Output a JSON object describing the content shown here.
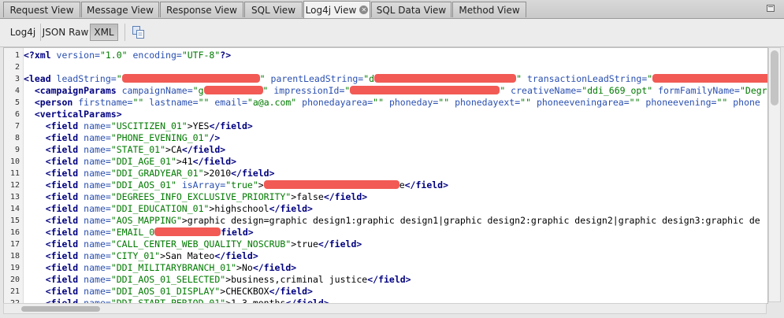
{
  "tabs": [
    {
      "label": "Request View"
    },
    {
      "label": "Message View"
    },
    {
      "label": "Response View"
    },
    {
      "label": "SQL View"
    },
    {
      "label": "Log4j View",
      "active": true,
      "closable": true
    },
    {
      "label": "SQL Data View"
    },
    {
      "label": "Method View"
    }
  ],
  "toolbar": {
    "log4j_label": "Log4j",
    "json_raw_label": "JSON Raw",
    "xml_label": "XML",
    "selected": "XML",
    "copy_icon": "copy-icon"
  },
  "editor": {
    "lines": [
      {
        "n": "1",
        "s": [
          [
            "t",
            "<?xml"
          ],
          [
            "a",
            " version="
          ],
          [
            "v",
            "\"1.0\""
          ],
          [
            "a",
            " encoding="
          ],
          [
            "v",
            "\"UTF-8\""
          ],
          [
            "t",
            "?>"
          ]
        ]
      },
      {
        "n": "2",
        "s": []
      },
      {
        "n": "3",
        "s": [
          [
            "t",
            "<lead"
          ],
          [
            "a",
            " leadString="
          ],
          [
            "v",
            "\""
          ],
          [
            "r",
            "175"
          ],
          [
            "v",
            "\""
          ],
          [
            "a",
            " parentLeadString="
          ],
          [
            "v",
            "\"d"
          ],
          [
            "r",
            "180"
          ],
          [
            "v",
            "\""
          ],
          [
            "a",
            " transactionLeadString="
          ],
          [
            "v",
            "\""
          ],
          [
            "r",
            "160"
          ]
        ]
      },
      {
        "n": "4",
        "s": [
          [
            "t",
            "  <campaignParams"
          ],
          [
            "a",
            " campaignName="
          ],
          [
            "v",
            "\"g"
          ],
          [
            "r",
            "75"
          ],
          [
            "v",
            "\""
          ],
          [
            "a",
            " impressionId="
          ],
          [
            "v",
            "\""
          ],
          [
            "r",
            "190"
          ],
          [
            "v",
            "\""
          ],
          [
            "a",
            " creativeName="
          ],
          [
            "v",
            "\"ddi_669_opt\""
          ],
          [
            "a",
            " formFamilyName="
          ],
          [
            "v",
            "\"Degree"
          ]
        ]
      },
      {
        "n": "5",
        "s": [
          [
            "t",
            "  <person"
          ],
          [
            "a",
            " firstname="
          ],
          [
            "v",
            "\"\""
          ],
          [
            "a",
            " lastname="
          ],
          [
            "v",
            "\"\""
          ],
          [
            "a",
            " email="
          ],
          [
            "v",
            "\"a@a.com\""
          ],
          [
            "a",
            " phonedayarea="
          ],
          [
            "v",
            "\"\""
          ],
          [
            "a",
            " phoneday="
          ],
          [
            "v",
            "\"\""
          ],
          [
            "a",
            " phonedayext="
          ],
          [
            "v",
            "\"\""
          ],
          [
            "a",
            " phoneeveningarea="
          ],
          [
            "v",
            "\"\""
          ],
          [
            "a",
            " phoneevening="
          ],
          [
            "v",
            "\"\""
          ],
          [
            "a",
            " phone"
          ]
        ]
      },
      {
        "n": "6",
        "s": [
          [
            "t",
            "  <verticalParams>"
          ]
        ]
      },
      {
        "n": "7",
        "s": [
          [
            "t",
            "    <field"
          ],
          [
            "a",
            " name="
          ],
          [
            "v",
            "\"USCITIZEN_01\""
          ],
          [
            "x",
            ">YES"
          ],
          [
            "t",
            "</field>"
          ]
        ]
      },
      {
        "n": "8",
        "s": [
          [
            "t",
            "    <field"
          ],
          [
            "a",
            " name="
          ],
          [
            "v",
            "\"PHONE_EVENING_01\""
          ],
          [
            "t",
            "/>"
          ]
        ]
      },
      {
        "n": "9",
        "s": [
          [
            "t",
            "    <field"
          ],
          [
            "a",
            " name="
          ],
          [
            "v",
            "\"STATE_01\""
          ],
          [
            "x",
            ">CA"
          ],
          [
            "t",
            "</field>"
          ]
        ]
      },
      {
        "n": "10",
        "s": [
          [
            "t",
            "    <field"
          ],
          [
            "a",
            " name="
          ],
          [
            "v",
            "\"DDI_AGE_01\""
          ],
          [
            "x",
            ">41"
          ],
          [
            "t",
            "</field>"
          ]
        ]
      },
      {
        "n": "11",
        "s": [
          [
            "t",
            "    <field"
          ],
          [
            "a",
            " name="
          ],
          [
            "v",
            "\"DDI_GRADYEAR_01\""
          ],
          [
            "x",
            ">2010"
          ],
          [
            "t",
            "</field>"
          ]
        ]
      },
      {
        "n": "12",
        "s": [
          [
            "t",
            "    <field"
          ],
          [
            "a",
            " name="
          ],
          [
            "v",
            "\"DDI_AOS_01\""
          ],
          [
            "a",
            " isArray="
          ],
          [
            "v",
            "\"true\""
          ],
          [
            "x",
            ">"
          ],
          [
            "r",
            "172"
          ],
          [
            "x",
            "e"
          ],
          [
            "t",
            "</field>"
          ]
        ]
      },
      {
        "n": "13",
        "s": [
          [
            "t",
            "    <field"
          ],
          [
            "a",
            " name="
          ],
          [
            "v",
            "\"DEGREES_INFO_EXCLUSIVE_PRIORITY\""
          ],
          [
            "x",
            ">false"
          ],
          [
            "t",
            "</field>"
          ]
        ]
      },
      {
        "n": "14",
        "s": [
          [
            "t",
            "    <field"
          ],
          [
            "a",
            " name="
          ],
          [
            "v",
            "\"DDI_EDUCATION_01\""
          ],
          [
            "x",
            ">highschool"
          ],
          [
            "t",
            "</field>"
          ]
        ]
      },
      {
        "n": "15",
        "s": [
          [
            "t",
            "    <field"
          ],
          [
            "a",
            " name="
          ],
          [
            "v",
            "\"AOS_MAPPING\""
          ],
          [
            "x",
            ">graphic design=graphic design1:graphic design1|graphic design2:graphic design2|graphic design3:graphic de"
          ]
        ]
      },
      {
        "n": "16",
        "s": [
          [
            "t",
            "    <field"
          ],
          [
            "a",
            " name="
          ],
          [
            "v",
            "\"EMAIL_0"
          ],
          [
            "r",
            "84"
          ],
          [
            "t",
            "field>"
          ]
        ]
      },
      {
        "n": "17",
        "s": [
          [
            "t",
            "    <field"
          ],
          [
            "a",
            " name="
          ],
          [
            "v",
            "\"CALL_CENTER_WEB_QUALITY_NOSCRUB\""
          ],
          [
            "x",
            ">true"
          ],
          [
            "t",
            "</field>"
          ]
        ]
      },
      {
        "n": "18",
        "s": [
          [
            "t",
            "    <field"
          ],
          [
            "a",
            " name="
          ],
          [
            "v",
            "\"CITY_01\""
          ],
          [
            "x",
            ">San Mateo"
          ],
          [
            "t",
            "</field>"
          ]
        ]
      },
      {
        "n": "19",
        "s": [
          [
            "t",
            "    <field"
          ],
          [
            "a",
            " name="
          ],
          [
            "v",
            "\"DDI_MILITARYBRANCH_01\""
          ],
          [
            "x",
            ">No"
          ],
          [
            "t",
            "</field>"
          ]
        ]
      },
      {
        "n": "20",
        "s": [
          [
            "t",
            "    <field"
          ],
          [
            "a",
            " name="
          ],
          [
            "v",
            "\"DDI_AOS_01_SELECTED\""
          ],
          [
            "x",
            ">business,criminal justice"
          ],
          [
            "t",
            "</field>"
          ]
        ]
      },
      {
        "n": "21",
        "s": [
          [
            "t",
            "    <field"
          ],
          [
            "a",
            " name="
          ],
          [
            "v",
            "\"DDI_AOS_01_DISPLAY\""
          ],
          [
            "x",
            ">CHECKBOX"
          ],
          [
            "t",
            "</field>"
          ]
        ]
      },
      {
        "n": "22",
        "s": [
          [
            "t",
            "    <field"
          ],
          [
            "a",
            " name="
          ],
          [
            "v",
            "\"DDI_START_PERIOD_01\""
          ],
          [
            "x",
            ">1-3 months"
          ],
          [
            "t",
            "</field>"
          ]
        ]
      }
    ]
  },
  "colors": {
    "tag": "#000080",
    "attribute": "#2a4fb0",
    "value": "#007a00",
    "redaction": "#f25a55"
  }
}
